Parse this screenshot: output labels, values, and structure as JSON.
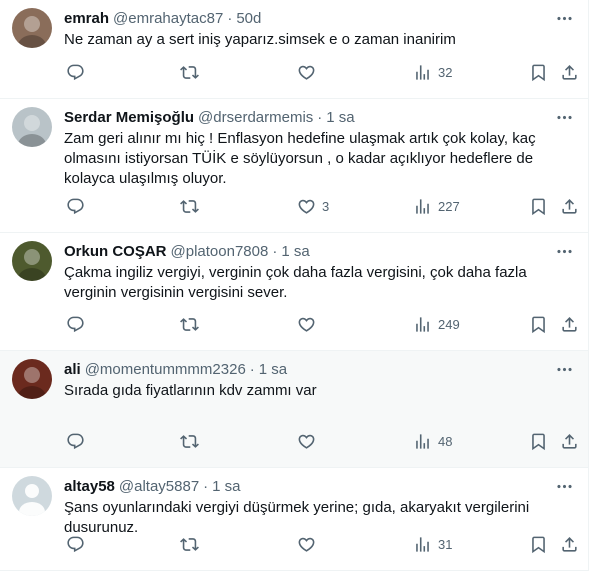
{
  "tweets": [
    {
      "name": "emrah",
      "handle": "@emrahaytac87",
      "sep": "·",
      "time": "50d",
      "text": "Ne zaman ay a sert iniş yaparız.simsek e o zaman inanirim",
      "replies": "",
      "reposts": "",
      "likes": "",
      "views": "32",
      "highlighted": false,
      "avatar_color": "#8a6d5a"
    },
    {
      "name": "Serdar Memişoğlu",
      "handle": "@drserdarmemis",
      "sep": "·",
      "time": "1 sa",
      "text": "Zam geri alınır mı hiç ! Enflasyon hedefine ulaşmak artık çok kolay, kaç olmasını istiyorsan TÜİK e söylüyorsun , o kadar açıklıyor hedeflere de kolayca ulaşılmış oluyor.",
      "replies": "",
      "reposts": "",
      "likes": "3",
      "views": "227",
      "highlighted": false,
      "avatar_color": "#b9c3c8"
    },
    {
      "name": "Orkun COŞAR",
      "handle": "@platoon7808",
      "sep": "·",
      "time": "1 sa",
      "text": "Çakma ingiliz vergiyi, verginin çok daha fazla vergisini, çok daha fazla verginin vergisinin vergisini sever.",
      "replies": "",
      "reposts": "",
      "likes": "",
      "views": "249",
      "highlighted": false,
      "avatar_color": "#4e5a2e"
    },
    {
      "name": "ali",
      "handle": "@momentummmm2326",
      "sep": "·",
      "time": "1 sa",
      "text": "Sırada gıda fiyatlarının kdv zammı var",
      "replies": "",
      "reposts": "",
      "likes": "",
      "views": "48",
      "highlighted": true,
      "avatar_color": "#6b2a1e"
    },
    {
      "name": "altay58",
      "handle": "@altay5887",
      "sep": "·",
      "time": "1 sa",
      "text": "Şans oyunlarındaki vergiyi düşürmek yerine; gıda, akaryakıt vergilerini dusurunuz.",
      "replies": "",
      "reposts": "",
      "likes": "",
      "views": "31",
      "highlighted": false,
      "avatar_color": "#cfd9de"
    }
  ]
}
